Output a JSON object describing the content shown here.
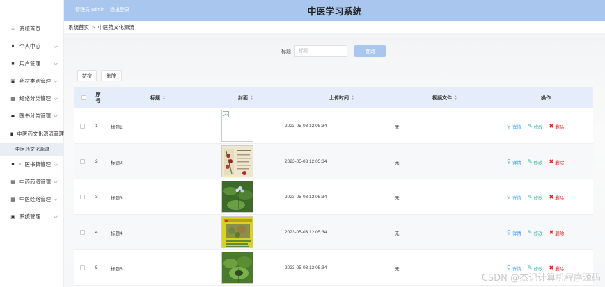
{
  "header": {
    "admin_label": "管理员 admin",
    "logout_label": "退出登录",
    "system_title": "中医学习系统"
  },
  "sidebar": {
    "items": [
      {
        "label": "系统首页",
        "icon": "home-icon"
      },
      {
        "label": "个人中心",
        "icon": "user-icon"
      },
      {
        "label": "用户管理",
        "icon": "users-icon"
      },
      {
        "label": "药材类别管理",
        "icon": "category-icon"
      },
      {
        "label": "经络分类管理",
        "icon": "grid-icon"
      },
      {
        "label": "医书分类管理",
        "icon": "location-icon"
      },
      {
        "label": "中医药文化源流管理",
        "icon": "chart-icon"
      },
      {
        "label": "中医书籍管理",
        "icon": "book-icon"
      },
      {
        "label": "中药药谱管理",
        "icon": "grid-icon"
      },
      {
        "label": "中医经络管理",
        "icon": "grid-icon"
      },
      {
        "label": "系统管理",
        "icon": "settings-icon"
      }
    ],
    "active_sub": "中医药文化源流"
  },
  "breadcrumb": {
    "home": "系统首页",
    "separator": ">",
    "current": "中医药文化源流"
  },
  "search": {
    "label": "标题",
    "placeholder": "标题",
    "button": "查询"
  },
  "actions": {
    "add": "新增",
    "delete": "删除"
  },
  "table": {
    "headers": {
      "index_line1": "序",
      "index_line2": "号",
      "title": "标题",
      "cover": "封面",
      "upload_time": "上传时间",
      "video_file": "视频文件",
      "operation": "操作"
    },
    "rows": [
      {
        "index": "1",
        "title": "标题1",
        "upload_time": "2023-05-03 12:05:34",
        "video": "无",
        "cover": "broken"
      },
      {
        "index": "2",
        "title": "标题2",
        "upload_time": "2023-05-03 12:05:34",
        "video": "无",
        "cover": "herb-chart"
      },
      {
        "index": "3",
        "title": "标题3",
        "upload_time": "2023-05-03 12:05:34",
        "video": "无",
        "cover": "green-plant"
      },
      {
        "index": "4",
        "title": "标题4",
        "upload_time": "2023-05-03 12:05:34",
        "video": "无",
        "cover": "yellow-poster"
      },
      {
        "index": "5",
        "title": "标题5",
        "upload_time": "2023-05-03 12:05:34",
        "video": "无",
        "cover": "leafy-plant"
      }
    ],
    "row_actions": {
      "detail": "详情",
      "edit": "修改",
      "remove": "删除"
    }
  },
  "watermark": "CSDN @杰记计算机程序源码",
  "colors": {
    "header_bg": "#a9c7ee",
    "table_head_bg": "#e4edf9",
    "detail": "#409eff",
    "edit": "#2bb5a5",
    "remove": "#e02020"
  }
}
